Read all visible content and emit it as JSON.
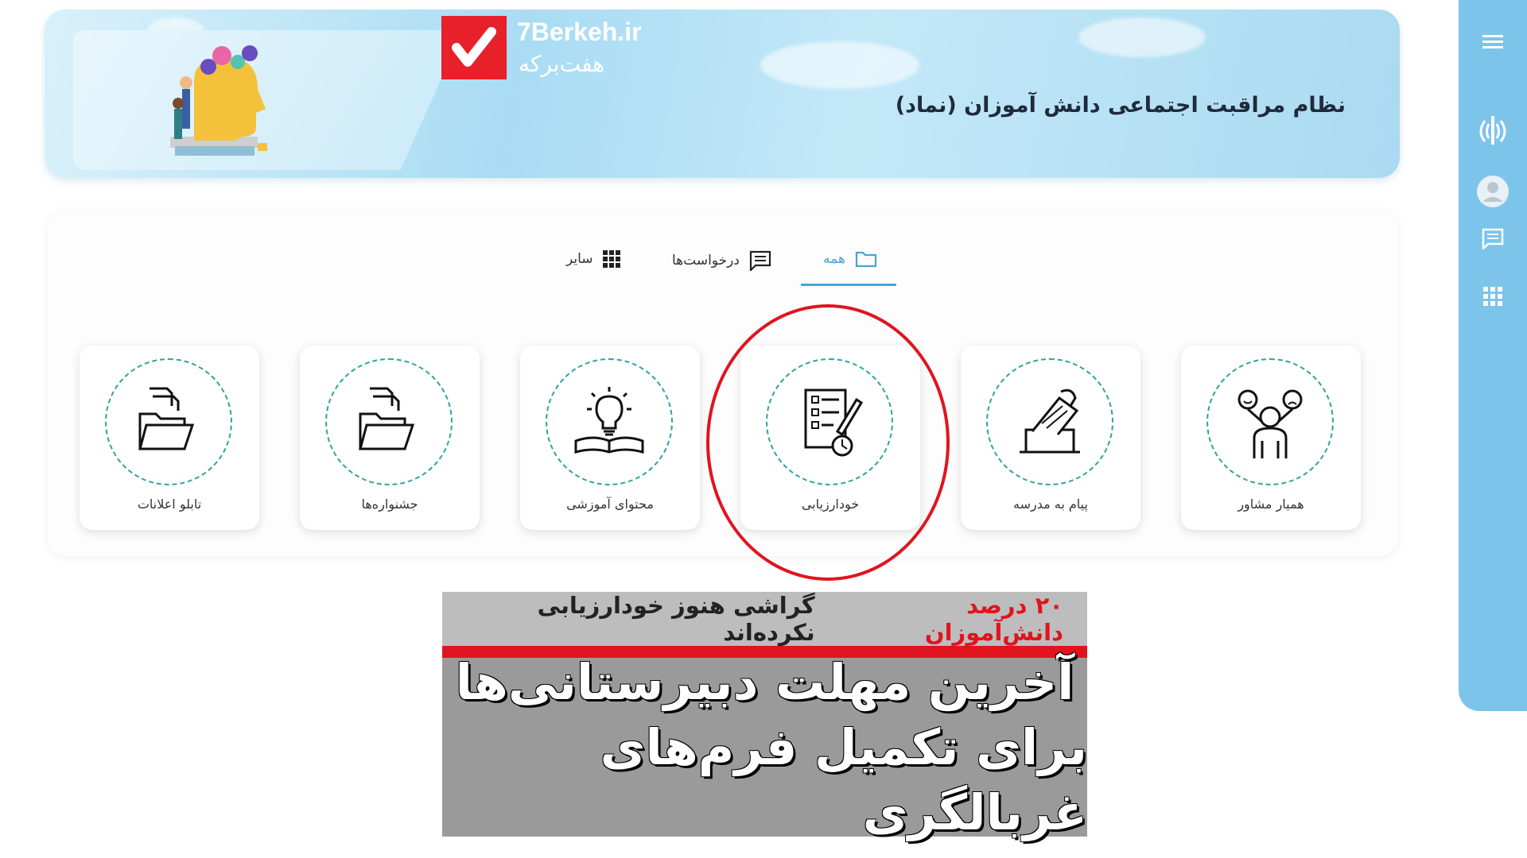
{
  "header": {
    "title": "نظام مراقبت اجتماعی دانش آموزان (نماد)"
  },
  "logo": {
    "site": "7Berkeh.ir",
    "name_fa": "هفت‌برکه",
    "color": "#e8202a"
  },
  "sidebar": {
    "items": [
      {
        "icon": "menu-icon"
      },
      {
        "icon": "emblem-icon"
      },
      {
        "icon": "user-avatar-icon"
      },
      {
        "icon": "chat-icon"
      },
      {
        "icon": "grid-icon"
      }
    ]
  },
  "tabs": [
    {
      "label": "همه",
      "icon": "folder-icon",
      "active": true
    },
    {
      "label": "درخواست‌ها",
      "icon": "chat-icon",
      "active": false
    },
    {
      "label": "سایر",
      "icon": "grid-icon",
      "active": false
    }
  ],
  "tiles": [
    {
      "label": "همیار مشاور",
      "icon": "counselor-icon"
    },
    {
      "label": "پیام به مدرسه",
      "icon": "ballot-message-icon"
    },
    {
      "label": "خودارزیابی",
      "icon": "self-assessment-icon"
    },
    {
      "label": "محتوای آموزشی",
      "icon": "book-lightbulb-icon"
    },
    {
      "label": "جشنواره‌ها",
      "icon": "folder-files-icon"
    },
    {
      "label": "تابلو اعلانات",
      "icon": "folder-files-icon"
    }
  ],
  "news": {
    "red_part": "۲۰ درصد دانش‌آموزان",
    "dark_part": "گراشی هنوز خودارزیابی نکرده‌اند",
    "headline_line1": "آخرین مهلت دبیرستانی‌ها",
    "headline_line2": "برای تکمیل فرم‌های غربالگری",
    "accent_color": "#e0141e"
  },
  "colors": {
    "active_tab": "#4aa3d8",
    "ring": "#2ea59b",
    "sidebar": "#7cc4ea"
  }
}
